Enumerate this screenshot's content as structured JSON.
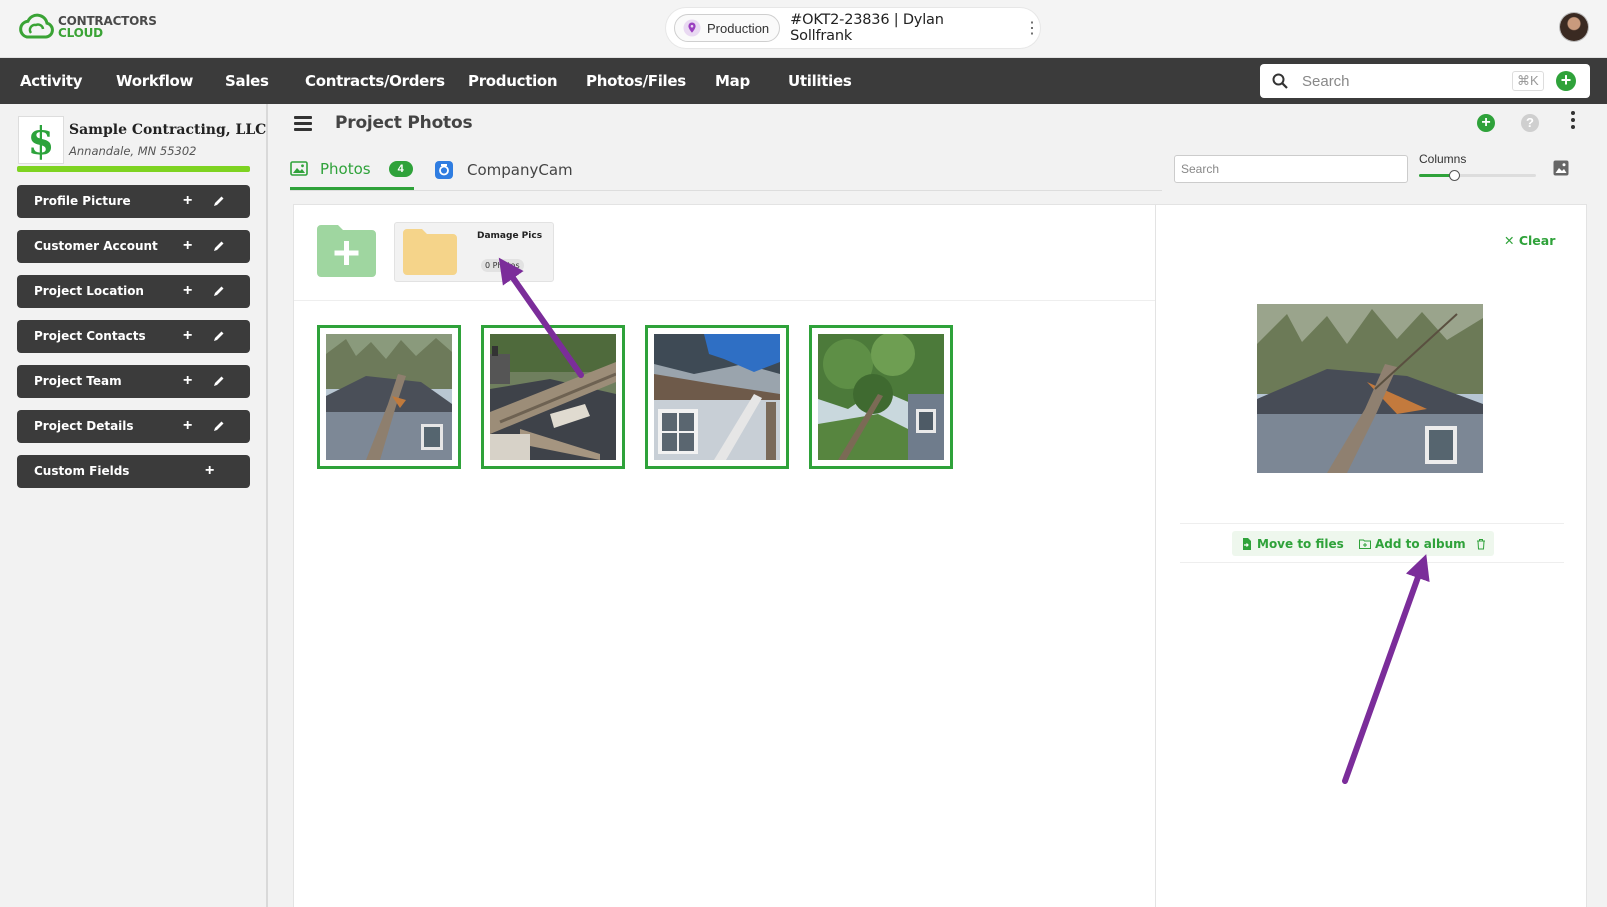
{
  "brand": {
    "line1": "CONTRACTORS",
    "line2": "CLOUD"
  },
  "project": {
    "stage": "Production",
    "id_name": "#OKT2-23836 | Dylan Sollfrank"
  },
  "nav": {
    "items": [
      "Activity",
      "Workflow",
      "Sales",
      "Contracts/Orders",
      "Production",
      "Photos/Files",
      "Map",
      "Utilities"
    ],
    "search_placeholder": "Search",
    "shortcut": "⌘K"
  },
  "company": {
    "name": "Sample Contracting, LLC",
    "address": "Annandale, MN 55302"
  },
  "sidebar": {
    "items": [
      {
        "label": "Profile Picture"
      },
      {
        "label": "Customer Account"
      },
      {
        "label": "Project Location"
      },
      {
        "label": "Project Contacts"
      },
      {
        "label": "Project Team"
      },
      {
        "label": "Project Details"
      },
      {
        "label": "Custom Fields"
      }
    ]
  },
  "page": {
    "title": "Project Photos"
  },
  "tabs": {
    "photos": {
      "label": "Photos",
      "count": "4"
    },
    "companycam": {
      "label": "CompanyCam"
    }
  },
  "toolbar": {
    "search_placeholder": "Search",
    "columns_label": "Columns",
    "columns_level": 0.3
  },
  "albums": [
    {
      "name": "Damage Pics",
      "count_label": "0 Photos"
    }
  ],
  "photos": [
    {
      "subject": "tree-on-roof"
    },
    {
      "subject": "fallen-trunk-closeup"
    },
    {
      "subject": "tarped-roof-damage"
    },
    {
      "subject": "branches-over-house"
    }
  ],
  "detail": {
    "clear_label": "Clear",
    "move_label": "Move to files",
    "album_label": "Add to album"
  },
  "colors": {
    "accent": "#2fa23a",
    "nav_bg": "#3b3b3b",
    "annotation_arrow": "#7b2d9a",
    "folder": "#f5d48a"
  }
}
